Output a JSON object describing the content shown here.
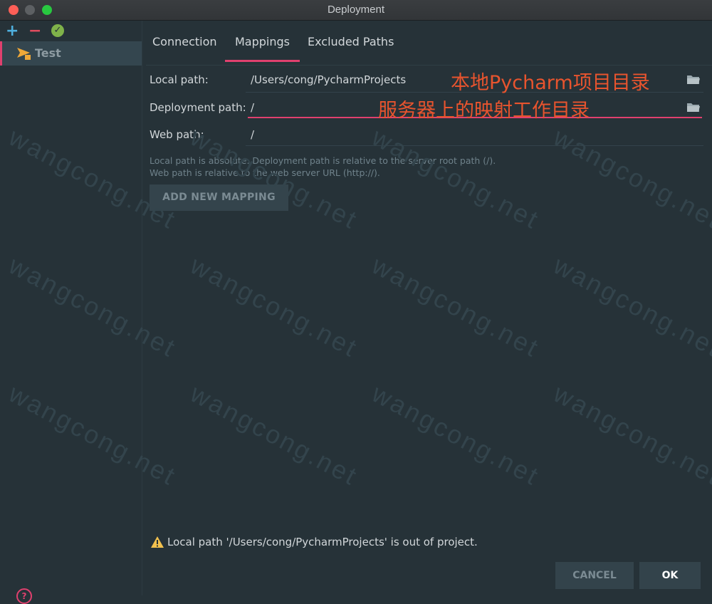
{
  "window": {
    "title": "Deployment"
  },
  "sidebar": {
    "toolbar": {
      "add": "+",
      "remove": "−",
      "check": "✓"
    },
    "servers": [
      {
        "label": "Test"
      }
    ],
    "help": "?"
  },
  "tabs": [
    {
      "label": "Connection"
    },
    {
      "label": "Mappings",
      "active": true
    },
    {
      "label": "Excluded Paths"
    }
  ],
  "mapping": {
    "local_label": "Local path:",
    "local_value": "/Users/cong/PycharmProjects",
    "deploy_label": "Deployment path:",
    "deploy_value": "/",
    "web_label": "Web path:",
    "web_value": "/"
  },
  "annotations": {
    "local": "本地Pycharm项目目录",
    "deploy": "服务器上的映射工作目录"
  },
  "hints": {
    "line1": "Local path is absolute. Deployment path is relative to the server root path (/).",
    "line2": "Web path is relative to the web server URL (http://)."
  },
  "add_mapping_label": "ADD NEW MAPPING",
  "warning": "Local path '/Users/cong/PycharmProjects' is out of project.",
  "buttons": {
    "cancel": "CANCEL",
    "ok": "OK"
  },
  "watermark": "wangcong.net",
  "colors": {
    "accent": "#e0406e",
    "annotation": "#e8542e",
    "background": "#263238"
  }
}
